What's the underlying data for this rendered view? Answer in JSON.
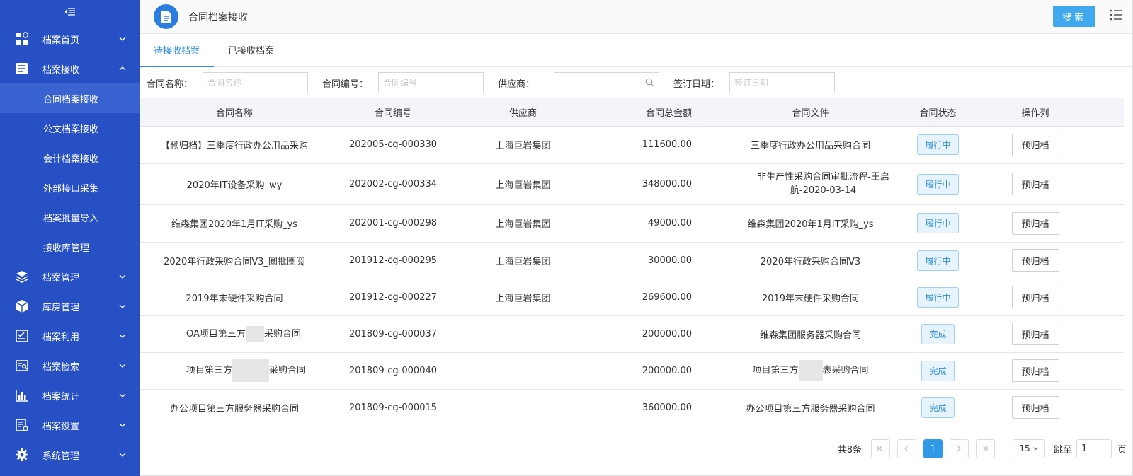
{
  "sidebar": {
    "items": [
      {
        "label": "档案首页",
        "icon": "dashboard-icon",
        "expanded": false
      },
      {
        "label": "档案接收",
        "icon": "document-list-icon",
        "expanded": true,
        "children": [
          "合同档案接收",
          "公文档案接收",
          "会计档案接收",
          "外部接口采集",
          "档案批量导入",
          "接收库管理"
        ]
      },
      {
        "label": "档案管理",
        "icon": "layers-icon",
        "expanded": false
      },
      {
        "label": "库房管理",
        "icon": "cube-icon",
        "expanded": false
      },
      {
        "label": "档案利用",
        "icon": "checklist-icon",
        "expanded": false
      },
      {
        "label": "档案检索",
        "icon": "search-doc-icon",
        "expanded": false
      },
      {
        "label": "档案统计",
        "icon": "bar-chart-icon",
        "expanded": false
      },
      {
        "label": "档案设置",
        "icon": "doc-settings-icon",
        "expanded": false
      },
      {
        "label": "系统管理",
        "icon": "gear-icon",
        "expanded": false
      }
    ],
    "active_child": "合同档案接收"
  },
  "header": {
    "title": "合同档案接收",
    "search_label": "搜索"
  },
  "tabs": [
    {
      "label": "待接收档案",
      "active": true
    },
    {
      "label": "已接收档案",
      "active": false
    }
  ],
  "filters": {
    "contract_name": {
      "label": "合同名称：",
      "placeholder": "合同名称",
      "value": ""
    },
    "contract_no": {
      "label": "合同编号：",
      "placeholder": "合同编号",
      "value": ""
    },
    "supplier": {
      "label": "供应商：",
      "placeholder": "",
      "value": ""
    },
    "sign_date": {
      "label": "签订日期：",
      "placeholder": "签订日期",
      "value": ""
    }
  },
  "table": {
    "columns": [
      "合同名称",
      "合同编号",
      "供应商",
      "合同总金额",
      "合同文件",
      "合同状态",
      "操作列"
    ],
    "rows": [
      {
        "name": "【预归档】三季度行政办公用品采购",
        "no": "202005-cg-000330",
        "supplier": "上海巨岩集团",
        "amount": "111600.00",
        "file": "三季度行政办公用品采购合同",
        "status": "履行中",
        "action": "预归档"
      },
      {
        "name": "2020年IT设备采购_wy",
        "no": "202002-cg-000334",
        "supplier": "上海巨岩集团",
        "amount": "348000.00",
        "file": "非生产性采购合同审批流程-王启航-2020-03-14",
        "status": "履行中",
        "action": "预归档"
      },
      {
        "name": "维森集团2020年1月IT采购_ys",
        "no": "202001-cg-000298",
        "supplier": "上海巨岩集团",
        "amount": "49000.00",
        "file": "维森集团2020年1月IT采购_ys",
        "status": "履行中",
        "action": "预归档"
      },
      {
        "name": "2020年行政采购合同V3_圈批圈阅",
        "no": "201912-cg-000295",
        "supplier": "上海巨岩集团",
        "amount": "30000.00",
        "file": "2020年行政采购合同V3",
        "status": "履行中",
        "action": "预归档"
      },
      {
        "name": "2019年末硬件采购合同",
        "no": "201912-cg-000227",
        "supplier": "上海巨岩集团",
        "amount": "269600.00",
        "file": "2019年末硬件采购合同",
        "status": "履行中",
        "action": "预归档"
      },
      {
        "name_a": "OA项目第三方",
        "name_b": "采购合同",
        "no": "201809-cg-000037",
        "supplier": "",
        "amount": "200000.00",
        "file": "维森集团服务器采购合同",
        "status": "完成",
        "action": "预归档"
      },
      {
        "name_a": "项目第三方",
        "name_b": "采购合同",
        "no": "201809-cg-000040",
        "supplier": "",
        "amount": "200000.00",
        "file_a": "项目第三方",
        "file_b": "表采购合同",
        "status": "完成",
        "action": "预归档"
      },
      {
        "name": "办公项目第三方服务器采购合同",
        "no": "201809-cg-000015",
        "supplier": "",
        "amount": "360000.00",
        "file": "办公项目第三方服务器采购合同",
        "status": "完成",
        "action": "预归档"
      }
    ]
  },
  "pager": {
    "total": "共8条",
    "current": "1",
    "page_size": "15",
    "jump_label": "跳至",
    "jump_value": "1",
    "page_suffix": "页"
  },
  "colors": {
    "sidebar_bg": "#2650c4",
    "accent": "#2f8fdf",
    "search_btn": "#3fa8ee"
  }
}
